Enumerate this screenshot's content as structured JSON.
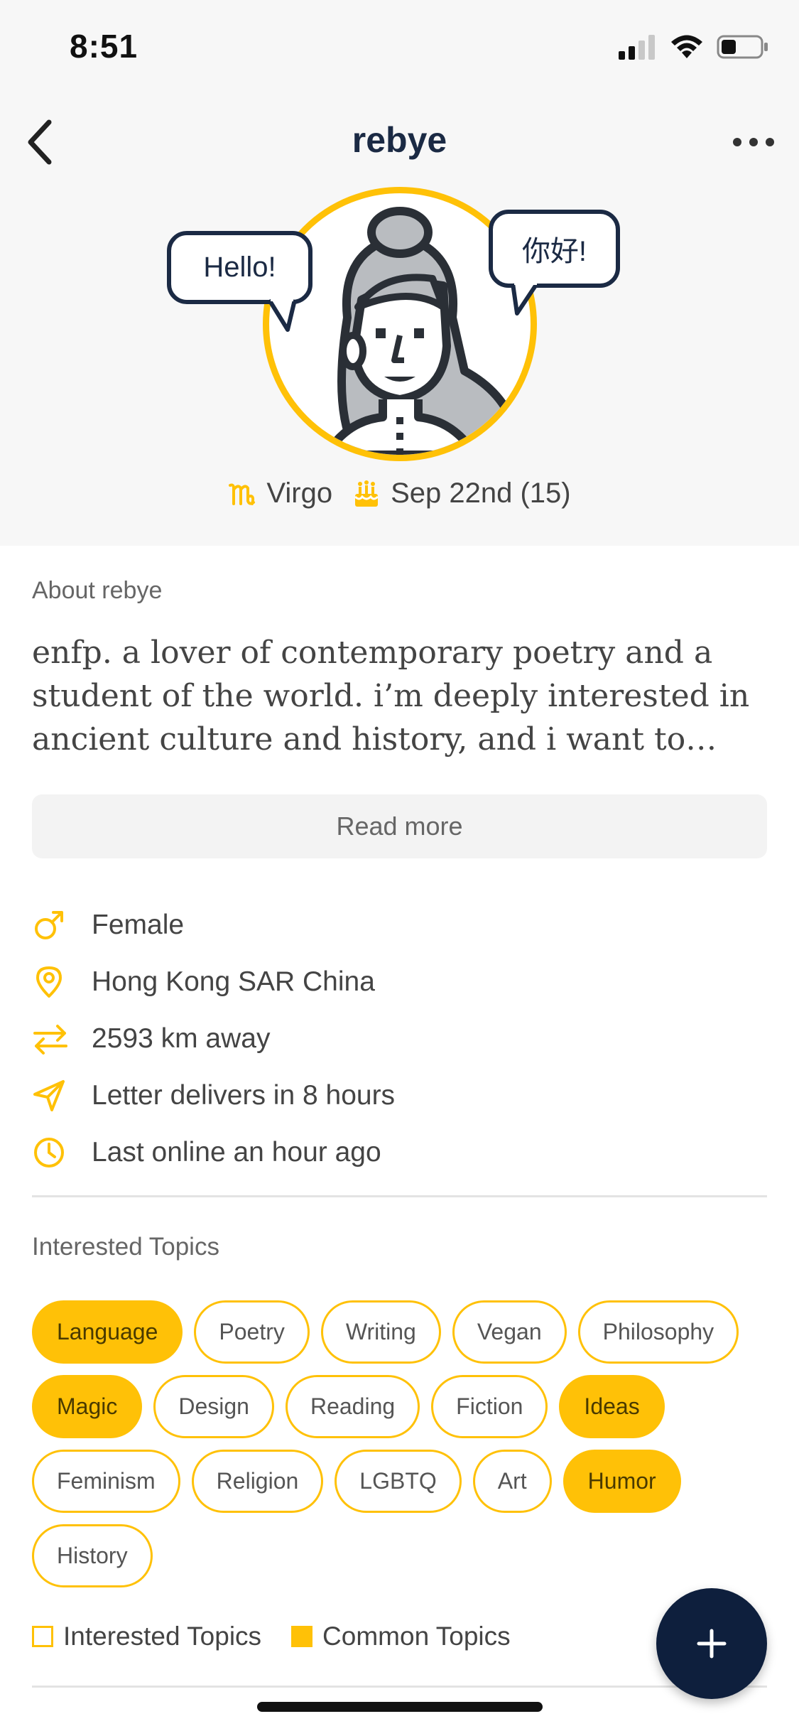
{
  "status_bar": {
    "time": "8:51"
  },
  "nav": {
    "title": "rebye"
  },
  "avatar": {
    "bubble_left": "Hello!",
    "bubble_right": "你好!"
  },
  "zodiac": {
    "sign": "Virgo",
    "birthday": "Sep 22nd (15)"
  },
  "about": {
    "label": "About rebye",
    "text": "enfp. a lover of contemporary poetry and a student of the world. i’m deeply interested in ancient culture and history, and i want to love…",
    "read_more": "Read more"
  },
  "info": [
    {
      "icon": "gender-icon",
      "text": "Female"
    },
    {
      "icon": "location-pin-icon",
      "text": "Hong Kong SAR China"
    },
    {
      "icon": "distance-arrows-icon",
      "text": "2593 km away"
    },
    {
      "icon": "paper-plane-icon",
      "text": "Letter delivers in 8 hours"
    },
    {
      "icon": "clock-icon",
      "text": "Last online an hour ago"
    }
  ],
  "topics": {
    "label": "Interested Topics",
    "rows": [
      [
        {
          "name": "Language",
          "common": true
        },
        {
          "name": "Poetry",
          "common": false
        },
        {
          "name": "Writing",
          "common": false
        },
        {
          "name": "Vegan",
          "common": false
        },
        {
          "name": "Philosophy",
          "common": false
        }
      ],
      [
        {
          "name": "Magic",
          "common": true
        },
        {
          "name": "Design",
          "common": false
        },
        {
          "name": "Reading",
          "common": false
        },
        {
          "name": "Fiction",
          "common": false
        },
        {
          "name": "Ideas",
          "common": true
        }
      ],
      [
        {
          "name": "Feminism",
          "common": false
        },
        {
          "name": "Religion",
          "common": false
        },
        {
          "name": "LGBTQ",
          "common": false
        },
        {
          "name": "Art",
          "common": false
        },
        {
          "name": "Humor",
          "common": true
        }
      ],
      [
        {
          "name": "History",
          "common": false
        }
      ]
    ]
  },
  "legend": {
    "interested": "Interested Topics",
    "common": "Common Topics"
  },
  "colors": {
    "accent": "#ffc107",
    "navy": "#1b2a44",
    "fab": "#0e1f3d"
  }
}
